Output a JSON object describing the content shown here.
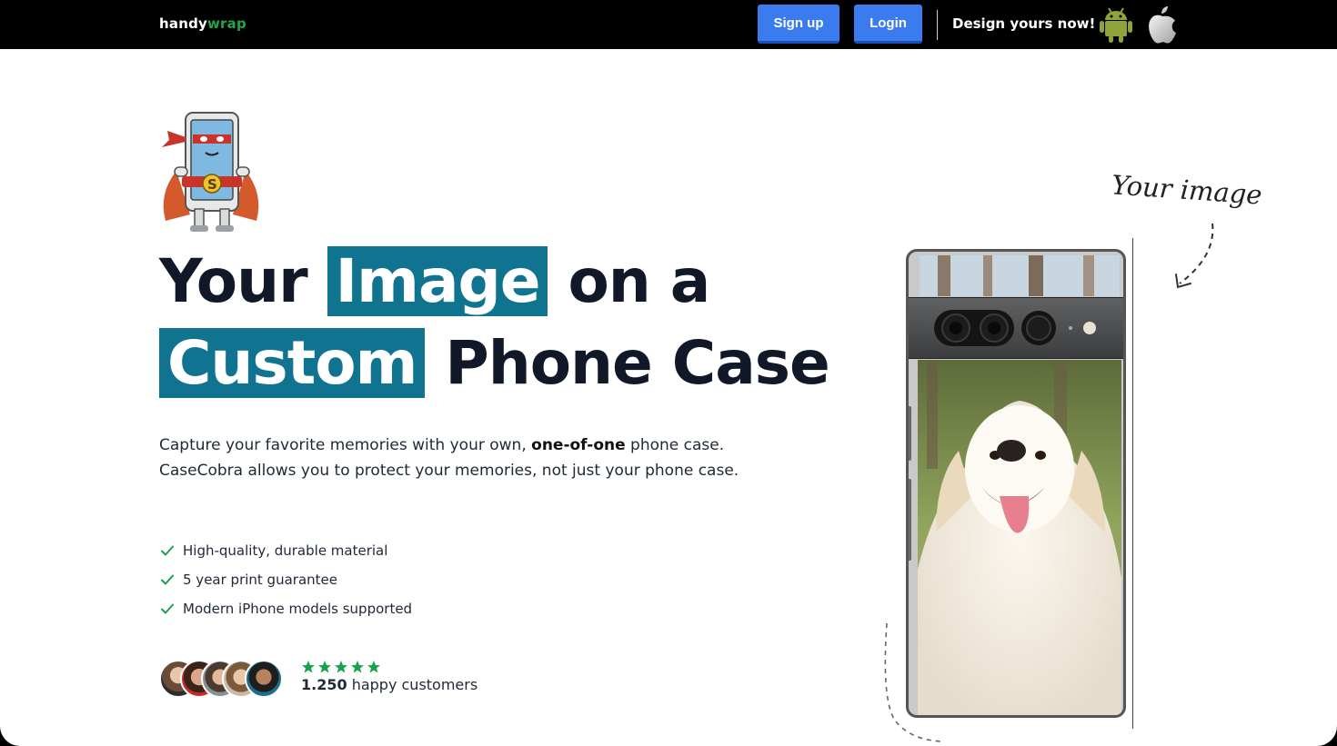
{
  "nav": {
    "logo_main": "handy",
    "logo_accent": "wrap",
    "signup_label": "Sign up",
    "login_label": "Login",
    "design_label": "Design yours now!"
  },
  "hero": {
    "line1_before": "Your",
    "line1_highlight": "Image",
    "line1_after": "on a",
    "line2_highlight": "Custom",
    "line2_after": "Phone Case",
    "desc_part1": "Capture your favorite memories with your own, ",
    "desc_bold": "one-of-one",
    "desc_part2": " phone case. CaseCobra allows you to protect your memories, not just your phone case.",
    "features": [
      "High-quality, durable material",
      "5 year print guarantee",
      "Modern iPhone models supported"
    ],
    "rating_stars": 5,
    "customers_count": "1.250",
    "customers_label": " happy customers"
  },
  "annotation": {
    "your_image": "Your image"
  },
  "colors": {
    "highlight": "#107491",
    "nav_button": "#3a7bef",
    "logo_accent": "#22a447",
    "check": "#16a34a",
    "star": "#16a34a"
  },
  "icons": [
    "android-icon",
    "apple-icon",
    "check-icon",
    "star-icon"
  ]
}
